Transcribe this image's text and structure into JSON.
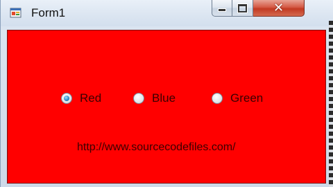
{
  "window": {
    "title": "Form1",
    "icon": "form-app-icon",
    "controls": {
      "minimize": "minimize-icon",
      "maximize": "maximize-icon",
      "close": "close-icon"
    }
  },
  "client": {
    "background_color": "#ff0000",
    "radios": [
      {
        "label": "Red",
        "checked": true
      },
      {
        "label": "Blue",
        "checked": false
      },
      {
        "label": "Green",
        "checked": false
      }
    ],
    "link_text": "http://www.sourcecodefiles.com/"
  }
}
